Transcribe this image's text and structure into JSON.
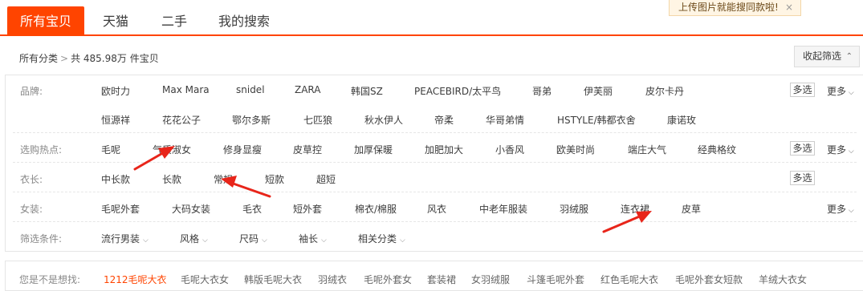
{
  "tabs": [
    {
      "label": "所有宝贝",
      "active": true
    },
    {
      "label": "天猫"
    },
    {
      "label": "二手"
    },
    {
      "label": "我的搜索"
    }
  ],
  "tip": {
    "text": "上传图片就能搜同款啦!",
    "close": "×"
  },
  "crumb": {
    "all": "所有分类",
    "sep": ">",
    "count": "共 485.98万 件宝贝"
  },
  "collapse": {
    "label": "收起筛选",
    "arrow": "⌃"
  },
  "filters": {
    "brand": {
      "label": "品牌:",
      "row1": [
        "欧时力",
        "Max Mara",
        "snidel",
        "ZARA",
        "韩国SZ",
        "PEACEBIRD/太平鸟",
        "哥弟",
        "伊芙丽",
        "皮尔卡丹"
      ],
      "row2": [
        "恒源祥",
        "花花公子",
        "鄂尔多斯",
        "七匹狼",
        "秋水伊人",
        "帝柔",
        "华哥弟情",
        "HSTYLE/韩都衣舍",
        "康诺玫"
      ],
      "multi": "多选",
      "more": "更多"
    },
    "hot": {
      "label": "选购热点:",
      "items": [
        "毛呢",
        "气质淑女",
        "修身显瘦",
        "皮草控",
        "加厚保暖",
        "加肥加大",
        "小香风",
        "欧美时尚",
        "端庄大气",
        "经典格纹"
      ],
      "multi": "多选",
      "more": "更多"
    },
    "length": {
      "label": "衣长:",
      "items": [
        "中长款",
        "长款",
        "常规",
        "短款",
        "超短"
      ],
      "multi": "多选"
    },
    "women": {
      "label": "女装:",
      "items": [
        "毛呢外套",
        "大码女装",
        "毛衣",
        "短外套",
        "棉衣/棉服",
        "风衣",
        "中老年服装",
        "羽绒服",
        "连衣裙",
        "皮草"
      ],
      "more": "更多"
    },
    "conditions": {
      "label": "筛选条件:",
      "items": [
        "流行男装",
        "风格",
        "尺码",
        "袖长",
        "相关分类"
      ]
    }
  },
  "suggest": {
    "label": "您是不是想找:",
    "items": [
      "1212毛呢大衣",
      "毛呢大衣女",
      "韩版毛呢大衣",
      "羽绒衣",
      "毛呢外套女",
      "套装裙",
      "女羽绒服",
      "斗篷毛呢外套",
      "红色毛呢大衣",
      "毛呢外套女短款",
      "羊绒大衣女"
    ]
  },
  "colors": {
    "accent": "#ff4400",
    "arrow": "#e8251a"
  }
}
